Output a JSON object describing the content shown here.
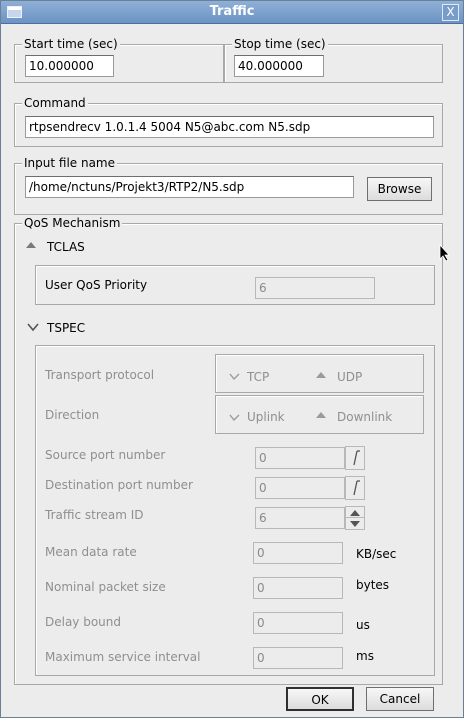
{
  "window": {
    "title": "Traffic",
    "close_label": "X"
  },
  "start_time": {
    "label": "Start time (sec)",
    "value": "10.000000"
  },
  "stop_time": {
    "label": "Stop time (sec)",
    "value": "40.000000"
  },
  "command": {
    "label": "Command",
    "value": "rtpsendrecv 1.0.1.4 5004 N5@abc.com N5.sdp"
  },
  "input_file": {
    "label": "Input file name",
    "value": "/home/nctuns/Projekt3/RTP2/N5.sdp",
    "browse_label": "Browse"
  },
  "qos": {
    "label": "QoS Mechanism",
    "tclas": {
      "label": "TCLAS",
      "user_qos_priority_label": "User QoS Priority",
      "user_qos_priority_value": "6"
    },
    "tspec": {
      "label": "TSPEC",
      "transport_protocol": {
        "label": "Transport protocol",
        "options": [
          "TCP",
          "UDP"
        ],
        "selected": "UDP"
      },
      "direction": {
        "label": "Direction",
        "options": [
          "Uplink",
          "Downlink"
        ],
        "selected": "Downlink"
      },
      "source_port": {
        "label": "Source port number",
        "value": "0"
      },
      "destination_port": {
        "label": "Destination port number",
        "value": "0"
      },
      "traffic_stream_id": {
        "label": "Traffic stream ID",
        "value": "6"
      },
      "mean_data_rate": {
        "label": "Mean data rate",
        "value": "0",
        "unit": "KB/sec"
      },
      "nominal_packet_size": {
        "label": "Nominal packet size",
        "value": "0",
        "unit": "bytes"
      },
      "delay_bound": {
        "label": "Delay bound",
        "value": "0",
        "unit": "us"
      },
      "max_service_interval": {
        "label": "Maximum service interval",
        "value": "0",
        "unit": "ms"
      }
    }
  },
  "buttons": {
    "ok": "OK",
    "cancel": "Cancel"
  }
}
